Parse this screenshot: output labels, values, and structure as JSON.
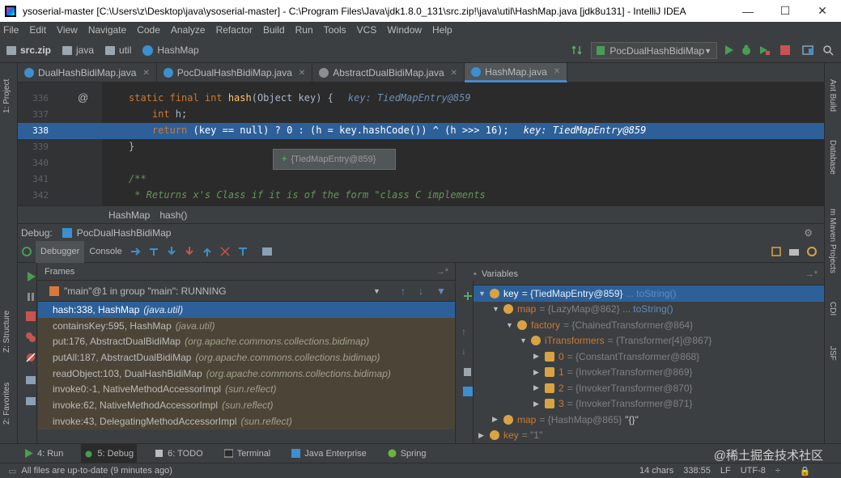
{
  "window": {
    "title": "ysoserial-master [C:\\Users\\z\\Desktop\\java\\ysoserial-master] - C:\\Program Files\\Java\\jdk1.8.0_131\\src.zip!\\java\\util\\HashMap.java [jdk8u131] - IntelliJ IDEA",
    "minimize": "—",
    "maximize": "☐",
    "close": "✕"
  },
  "menu": [
    "File",
    "Edit",
    "View",
    "Navigate",
    "Code",
    "Analyze",
    "Refactor",
    "Build",
    "Run",
    "Tools",
    "VCS",
    "Window",
    "Help"
  ],
  "nav": {
    "crumbs": [
      "src.zip",
      "java",
      "util",
      "HashMap"
    ],
    "run_config": "PocDualHashBidiMap"
  },
  "editor_tabs": [
    {
      "label": "DualHashBidiMap.java",
      "active": false
    },
    {
      "label": "PocDualHashBidiMap.java",
      "active": false
    },
    {
      "label": "AbstractDualBidiMap.java",
      "active": false
    },
    {
      "label": "HashMap.java",
      "active": true
    }
  ],
  "code": {
    "lines": [
      {
        "num": "336",
        "kw1": "static final int ",
        "fn": "hash",
        "rest": "(Object key) {",
        "hint": "key: TiedMapEntry@859",
        "exec": false
      },
      {
        "num": "337",
        "kw1": "    int ",
        "fn": "",
        "rest": "h;",
        "hint": "",
        "exec": false
      },
      {
        "num": "338",
        "kw1": "    return ",
        "fn": "",
        "rest": "(key == null) ? 0 : (h = key.hashCode()) ^ (h >>> 16);",
        "hint": "key: TiedMapEntry@859",
        "exec": true
      },
      {
        "num": "339",
        "kw1": "",
        "fn": "",
        "rest": "}",
        "hint": "",
        "exec": false
      },
      {
        "num": "340",
        "kw1": "",
        "fn": "",
        "rest": "",
        "hint": "",
        "exec": false
      },
      {
        "num": "341",
        "kw1": "",
        "fn": "",
        "rest": "/**",
        "hint": "",
        "exec": false,
        "comment": true
      },
      {
        "num": "342",
        "kw1": "",
        "fn": "",
        "rest": " * Returns x's Class if it is of the form \"class C implements",
        "hint": "",
        "exec": false,
        "comment": true
      }
    ],
    "tooltip": "{TiedMapEntry@859}"
  },
  "breadcrumb": [
    "HashMap",
    "hash()"
  ],
  "debug": {
    "label": "Debug:",
    "config": "PocDualHashBidiMap",
    "tabs": [
      "Debugger",
      "Console"
    ],
    "frames_title": "Frames",
    "thread": "\"main\"@1 in group \"main\": RUNNING",
    "frames": [
      {
        "method": "hash:338, HashMap",
        "pkg": "(java.util)",
        "sel": true
      },
      {
        "method": "containsKey:595, HashMap",
        "pkg": "(java.util)",
        "sel": false
      },
      {
        "method": "put:176, AbstractDualBidiMap",
        "pkg": "(org.apache.commons.collections.bidimap)",
        "sel": false
      },
      {
        "method": "putAll:187, AbstractDualBidiMap",
        "pkg": "(org.apache.commons.collections.bidimap)",
        "sel": false
      },
      {
        "method": "readObject:103, DualHashBidiMap",
        "pkg": "(org.apache.commons.collections.bidimap)",
        "sel": false
      },
      {
        "method": "invoke0:-1, NativeMethodAccessorImpl",
        "pkg": "(sun.reflect)",
        "sel": false
      },
      {
        "method": "invoke:62, NativeMethodAccessorImpl",
        "pkg": "(sun.reflect)",
        "sel": false
      },
      {
        "method": "invoke:43, DelegatingMethodAccessorImpl",
        "pkg": "(sun.reflect)",
        "sel": false
      }
    ],
    "variables_title": "Variables",
    "variables": [
      {
        "depth": 0,
        "tri": "▼",
        "icon": "field",
        "name": "key",
        "value": "= {TiedMapEntry@859}",
        "link": "... toString()",
        "extra": "",
        "sel": true
      },
      {
        "depth": 1,
        "tri": "▼",
        "icon": "field",
        "name": "map",
        "value": "= {LazyMap@862}",
        "link": "... toString()",
        "extra": "",
        "sel": false
      },
      {
        "depth": 2,
        "tri": "▼",
        "icon": "field",
        "name": "factory",
        "value": "= {ChainedTransformer@864}",
        "link": "",
        "extra": "",
        "sel": false
      },
      {
        "depth": 3,
        "tri": "▼",
        "icon": "field",
        "name": "iTransformers",
        "value": "= {Transformer[4]@867}",
        "link": "",
        "extra": "",
        "sel": false
      },
      {
        "depth": 4,
        "tri": "▶",
        "icon": "arr",
        "name": "0",
        "value": "= {ConstantTransformer@868}",
        "link": "",
        "extra": "",
        "sel": false
      },
      {
        "depth": 4,
        "tri": "▶",
        "icon": "arr",
        "name": "1",
        "value": "= {InvokerTransformer@869}",
        "link": "",
        "extra": "",
        "sel": false
      },
      {
        "depth": 4,
        "tri": "▶",
        "icon": "arr",
        "name": "2",
        "value": "= {InvokerTransformer@870}",
        "link": "",
        "extra": "",
        "sel": false
      },
      {
        "depth": 4,
        "tri": "▶",
        "icon": "arr",
        "name": "3",
        "value": "= {InvokerTransformer@871}",
        "link": "",
        "extra": "",
        "sel": false
      },
      {
        "depth": 1,
        "tri": "▶",
        "icon": "field",
        "name": "map",
        "value": "= {HashMap@865}",
        "link": "",
        "extra": "\"{}\"",
        "sel": false
      },
      {
        "depth": 0,
        "tri": "▶",
        "icon": "field",
        "name": "key",
        "value": "= \"1\"",
        "link": "",
        "extra": "",
        "sel": false
      }
    ]
  },
  "side_labels": {
    "left": [
      "1: Project",
      "Z: Structure",
      "2: Favorites"
    ],
    "right": [
      "Ant Build",
      "Database",
      "m Maven Projects",
      "CDI",
      "JSF"
    ]
  },
  "bottom_tabs": [
    {
      "label": "4: Run",
      "active": false
    },
    {
      "label": "5: Debug",
      "active": true
    },
    {
      "label": "6: TODO",
      "active": false
    },
    {
      "label": "Terminal",
      "active": false
    },
    {
      "label": "Java Enterprise",
      "active": false
    },
    {
      "label": "Spring",
      "active": false
    }
  ],
  "watermark": "@稀土掘金技术社区",
  "status": {
    "message": "All files are up-to-date (9 minutes ago)",
    "chars": "14 chars",
    "position": "338:55",
    "line_sep": "LF",
    "encoding": "UTF-8",
    "encoding_suffix": "÷"
  },
  "colors": {
    "accent": "#2d6099",
    "run_green": "#499c54",
    "stop_red": "#c75450"
  }
}
